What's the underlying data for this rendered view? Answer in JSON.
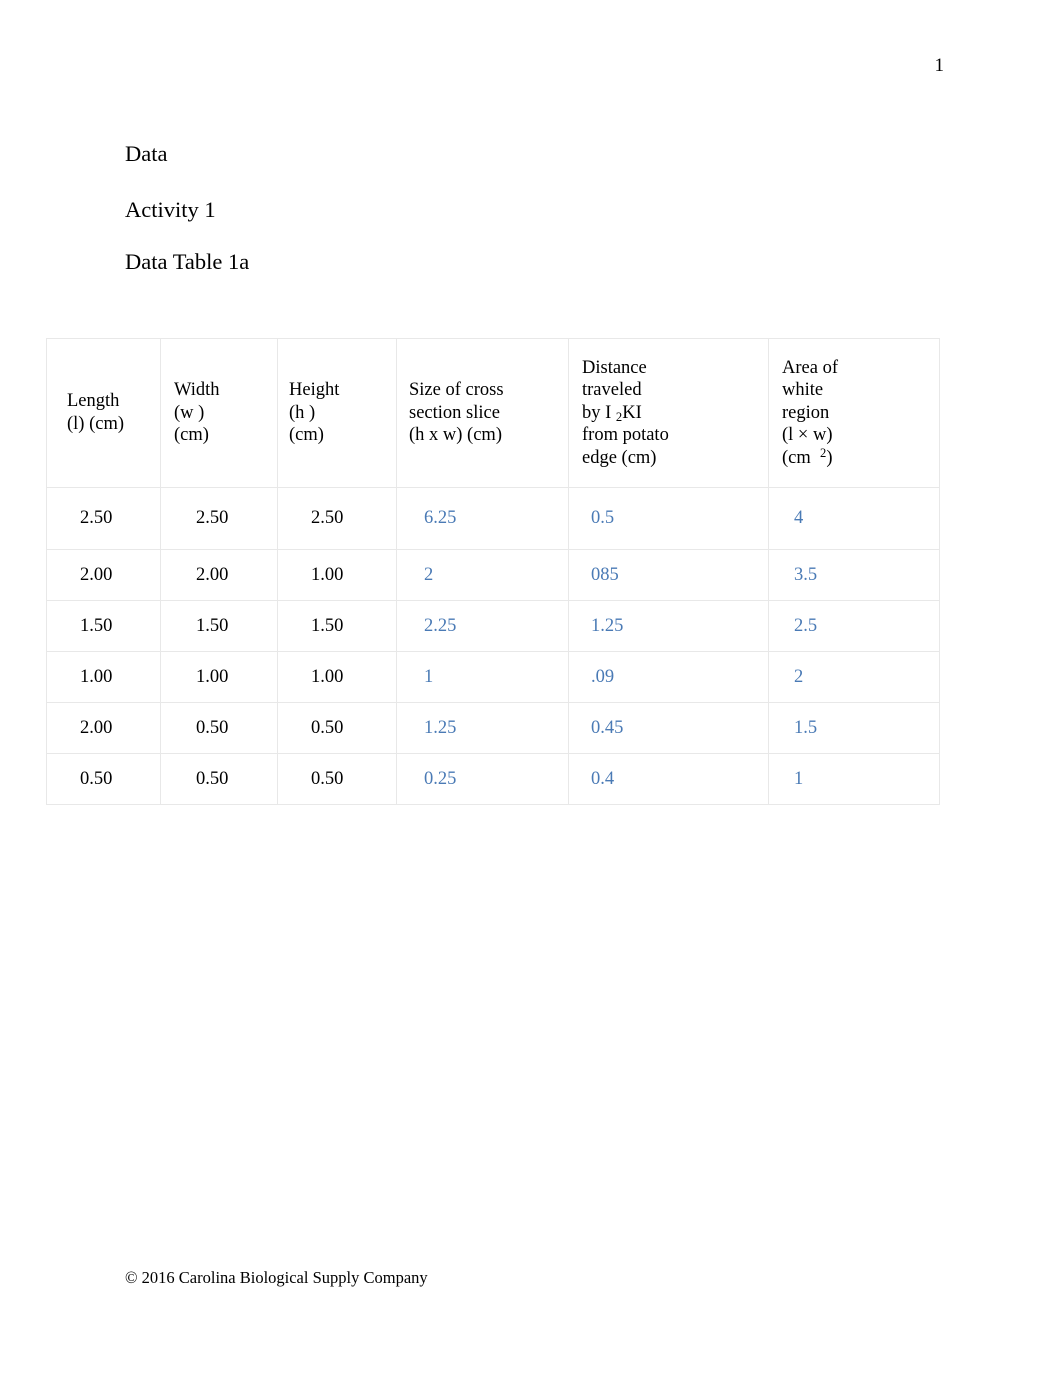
{
  "page": {
    "number": "1",
    "footer": "© 2016 Carolina Biological Supply Company"
  },
  "headings": {
    "data": "Data",
    "activity": "Activity 1",
    "table_title": "Data Table 1a"
  },
  "table": {
    "name": "Data Table 1a",
    "columns": [
      {
        "id": "length",
        "lines": [
          "Length",
          "(l) (cm)"
        ]
      },
      {
        "id": "width",
        "lines": [
          "Width",
          "(w )",
          "(cm)"
        ]
      },
      {
        "id": "height",
        "lines": [
          "Height",
          "(h )",
          "(cm)"
        ]
      },
      {
        "id": "cross-section",
        "lines": [
          "Size of cross",
          "section slice",
          "(h x w) (cm)"
        ]
      },
      {
        "id": "distance-traveled",
        "lines": [
          "Distance",
          "traveled",
          "by I ",
          "2",
          "KI",
          "from potato",
          "edge (cm)"
        ],
        "line1": "Distance",
        "line2": "traveled",
        "line3_pre": "by I ",
        "line3_sub": "2",
        "line3_post": "KI",
        "line4": "from potato",
        "line5": "edge (cm)"
      },
      {
        "id": "area-white-region",
        "lines": [
          "Area of",
          "white",
          "region",
          "(l × w)",
          "(cm  2)"
        ],
        "line1": "Area of",
        "line2": "white",
        "line3": "region",
        "line4": "(l × w)",
        "line5_pre": "(cm  ",
        "line5_sup": "2",
        "line5_post": ")"
      }
    ],
    "rows": [
      {
        "length": "2.50",
        "width": "2.50",
        "height": "2.50",
        "cross_section": "6.25",
        "distance": "0.5",
        "area": "4"
      },
      {
        "length": "2.00",
        "width": "2.00",
        "height": "1.00",
        "cross_section": "2",
        "distance": "085",
        "area": "3.5"
      },
      {
        "length": "1.50",
        "width": "1.50",
        "height": "1.50",
        "cross_section": "2.25",
        "distance": "1.25",
        "area": "2.5"
      },
      {
        "length": "1.00",
        "width": "1.00",
        "height": "1.00",
        "cross_section": "1",
        "distance": ".09",
        "area": "2"
      },
      {
        "length": "2.00",
        "width": "0.50",
        "height": "0.50",
        "cross_section": "1.25",
        "distance": "0.45",
        "area": "1.5"
      },
      {
        "length": "0.50",
        "width": "0.50",
        "height": "0.50",
        "cross_section": "0.25",
        "distance": "0.4",
        "area": "1"
      }
    ]
  },
  "colors": {
    "answer_text": "#4a7ab5",
    "body_text": "#000000",
    "table_border": "#e8e8e8"
  }
}
